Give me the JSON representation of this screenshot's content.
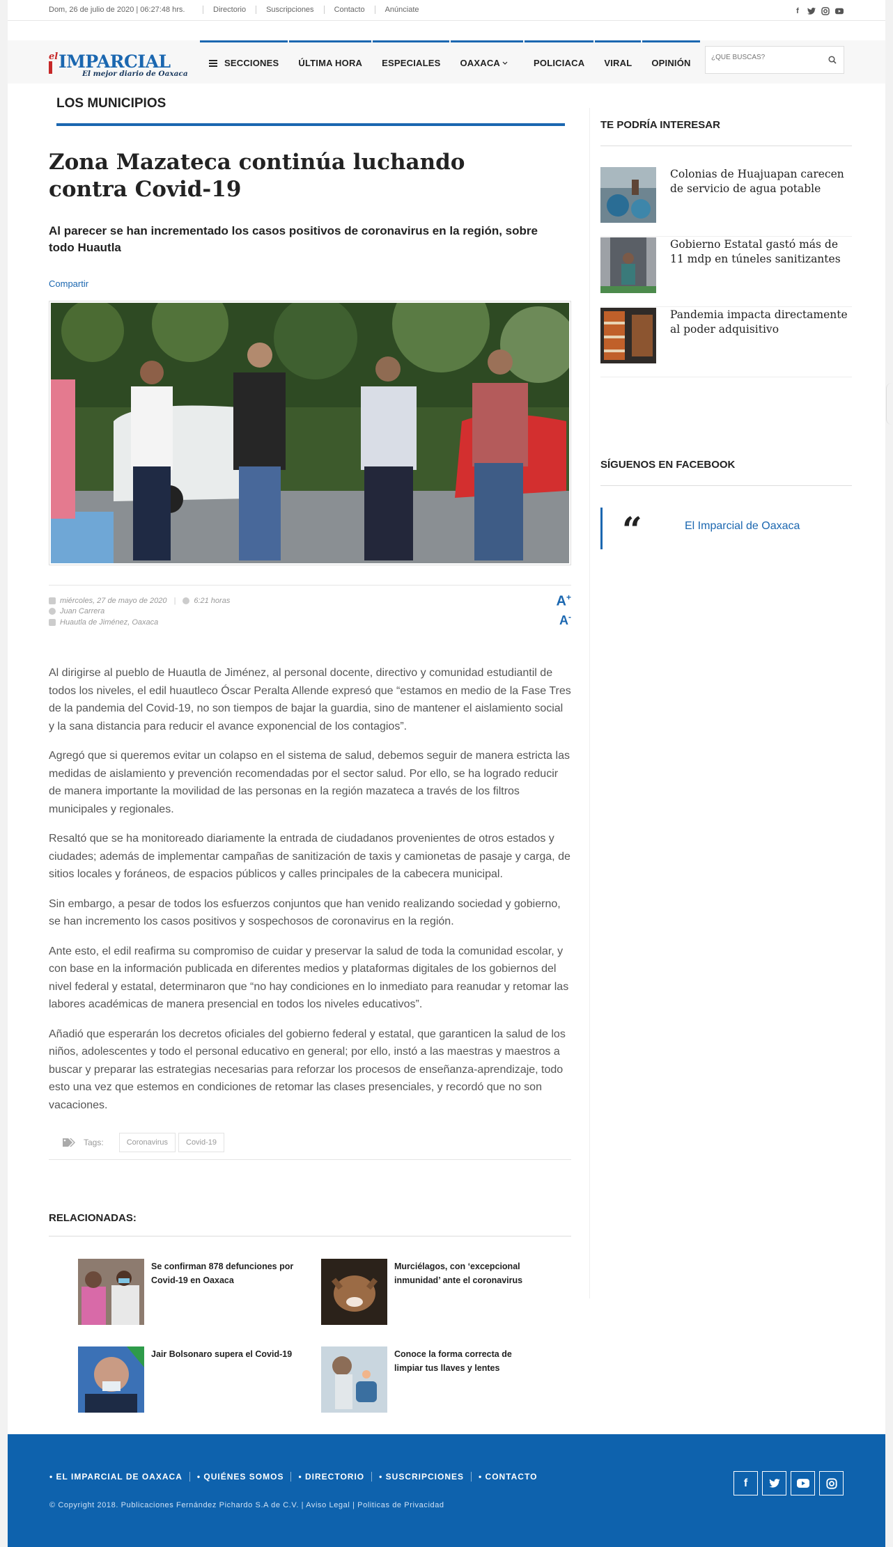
{
  "topbar": {
    "datetime": "Dom, 26 de julio de 2020 | 06:27:48 hrs.",
    "links": [
      "Directorio",
      "Suscripciones",
      "Contacto",
      "Anúnciate"
    ],
    "social_icons": [
      "facebook-icon",
      "twitter-icon",
      "instagram-icon",
      "youtube-icon"
    ]
  },
  "brand": {
    "logo_prefix": "el",
    "logo_name": "IMPARCIAL",
    "tagline": "El mejor diario de Oaxaca",
    "accent_color": "#1b67b0",
    "red_color": "#c62828"
  },
  "nav": {
    "sections": "SECCIONES",
    "ultima_hora": "ÚLTIMA HORA",
    "especiales": "ESPECIALES",
    "oaxaca": "OAXACA",
    "policiaca": "POLICIACA",
    "viral": "VIRAL",
    "opinion": "OPINIÓN"
  },
  "search": {
    "placeholder": "¿QUÉ BUSCAS?"
  },
  "article": {
    "section": "LOS MUNICIPIOS",
    "title": "Zona Mazateca continúa luchando contra Covid-19",
    "subtitle": "Al parecer se han incrementado los casos positivos de coronavirus en la región, sobre todo Huautla",
    "share": "Compartir",
    "date": "miércoles, 27 de mayo de 2020",
    "time": "6:21 horas",
    "author": "Juan Carrera",
    "location": "Huautla de Jiménez, Oaxaca",
    "font_up": "A",
    "font_down": "A",
    "paragraphs": [
      "Al dirigirse al pueblo de Huautla de Jiménez, al personal docente, directivo y comunidad estudiantil de todos los niveles, el edil huautleco Óscar Peralta Allende expresó que “estamos en medio de la Fase Tres de la pandemia del Covid-19, no son tiempos de bajar la guardia, sino de mantener el aislamiento social y la sana distancia para reducir el avance exponencial de los contagios”.",
      "Agregó que si queremos evitar un colapso en el sistema de salud, debemos seguir de manera estricta las medidas de aislamiento y prevención recomendadas por el sector salud. Por ello, se ha logrado reducir de manera importante la movilidad de las personas en la región mazateca a través de los filtros municipales y regionales.",
      "Resaltó que se ha monitoreado diariamente la entrada de ciudadanos provenientes de otros estados y ciudades; además de implementar campañas de sanitización de taxis y camionetas de pasaje y carga, de sitios locales y foráneos, de espacios públicos y calles principales de la cabecera municipal.",
      "Sin embargo, a pesar de todos los esfuerzos conjuntos que han venido realizando sociedad y gobierno, se han incremento los casos positivos y sospechosos de coronavirus en la región.",
      "Ante esto, el edil reafirma su compromiso de cuidar y preservar la salud de toda la comunidad escolar, y con base en la información publicada en diferentes medios y plataformas digitales de los gobiernos del nivel federal y estatal, determinaron que “no hay condiciones en lo inmediato para reanudar y retomar las labores académicas de manera presencial en todos los niveles educativos”.",
      "Añadió que esperarán los decretos oficiales del gobierno federal y estatal, que garanticen la salud de los niños, adolescentes y todo el personal educativo en general; por ello, instó a las maestras y maestros a buscar y preparar las estrategias necesarias para reforzar los procesos de enseñanza-aprendizaje, todo esto una vez que estemos en condiciones de retomar las clases presenciales, y recordó que no son vacaciones."
    ],
    "tags_label": "Tags:",
    "tags": [
      "Coronavirus",
      "Covid-19"
    ]
  },
  "related": {
    "title": "RELACIONADAS:",
    "items": [
      "Se confirman 878 defunciones por Covid-19 en Oaxaca",
      "Murciélagos, con ‘excepcional inmunidad’ ante el coronavirus",
      "Jair Bolsonaro supera el Covid-19",
      "Conoce la forma correcta de limpiar tus llaves y lentes"
    ]
  },
  "sidebar": {
    "interest_title": "TE PODRÍA INTERESAR",
    "interest_items": [
      "Colonias de Huajuapan carecen de servicio de agua potable",
      "Gobierno Estatal gastó más de 11 mdp en túneles sanitizantes",
      "Pandemia impacta directamente al poder adquisitivo"
    ],
    "facebook_title": "SÍGUENOS EN FACEBOOK",
    "facebook_quote": "“",
    "facebook_link": "El Imparcial de Oaxaca"
  },
  "footer": {
    "links": [
      "• EL IMPARCIAL DE OAXACA",
      "• QUIÉNES SOMOS",
      "• DIRECTORIO",
      "• SUSCRIPCIONES",
      "• CONTACTO"
    ],
    "copyright": "© Copyright 2018. Publicaciones Fernández Pichardo S.A de C.V. | Aviso Legal | Politicas de Privacidad",
    "background_color": "#0e62ad"
  }
}
